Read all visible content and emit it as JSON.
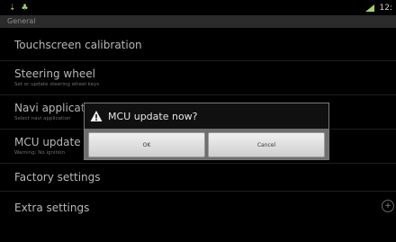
{
  "statusbar": {
    "left_icons": [
      "usb-icon",
      "notification-icon"
    ],
    "time": "12:"
  },
  "category": "General",
  "items": [
    {
      "title": "Touchscreen calibration",
      "summary": ""
    },
    {
      "title": "Steering wheel",
      "summary": "Set or update steering wheel keys"
    },
    {
      "title": "Navi application",
      "summary": "Select navi application"
    },
    {
      "title": "MCU update",
      "summary": "Warning: No ignition"
    },
    {
      "title": "Factory settings",
      "summary": ""
    },
    {
      "title": "Extra settings",
      "summary": ""
    }
  ],
  "dialog": {
    "title": "MCU update now?",
    "ok_label": "OK",
    "cancel_label": "Cancel"
  },
  "colors": {
    "accent_green": "#9fd46a",
    "background": "#000000"
  }
}
